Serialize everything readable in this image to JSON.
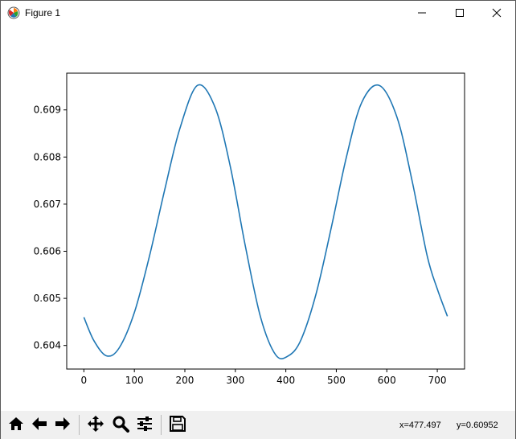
{
  "window": {
    "title": "Figure 1",
    "app_icon": "matplotlib-icon",
    "controls": [
      "minimize-icon",
      "maximize-icon",
      "close-icon"
    ]
  },
  "toolbar": {
    "buttons": [
      "home-icon",
      "back-icon",
      "forward-icon",
      "pan-icon",
      "zoom-icon",
      "configure-subplots-icon",
      "save-icon"
    ],
    "x_readout": "x=477.497",
    "y_readout": "y=0.60952"
  },
  "chart_data": {
    "type": "line",
    "xlim": [
      -34,
      754
    ],
    "ylim": [
      0.6035,
      0.60978
    ],
    "x_ticks": [
      0,
      100,
      200,
      300,
      400,
      500,
      600,
      700
    ],
    "x_tick_labels": [
      "0",
      "100",
      "200",
      "300",
      "400",
      "500",
      "600",
      "700"
    ],
    "y_ticks": [
      0.604,
      0.605,
      0.606,
      0.607,
      0.608,
      0.609
    ],
    "y_tick_labels": [
      "0.604",
      "0.605",
      "0.606",
      "0.607",
      "0.608",
      "0.609"
    ],
    "grid": false,
    "series": [
      {
        "color": "#1f77b4",
        "x": [
          0,
          20,
          45,
          70,
          100,
          130,
          160,
          190,
          225,
          260,
          290,
          320,
          350,
          380,
          405,
          430,
          460,
          490,
          520,
          550,
          585,
          620,
          650,
          680,
          700,
          720
        ],
        "y": [
          0.6046,
          0.6041,
          0.60378,
          0.60395,
          0.6047,
          0.6059,
          0.6073,
          0.6086,
          0.60952,
          0.60905,
          0.6078,
          0.6061,
          0.6046,
          0.6038,
          0.60378,
          0.60412,
          0.6051,
          0.6065,
          0.608,
          0.60915,
          0.60952,
          0.60885,
          0.6075,
          0.6059,
          0.6052,
          0.60462
        ]
      }
    ]
  }
}
